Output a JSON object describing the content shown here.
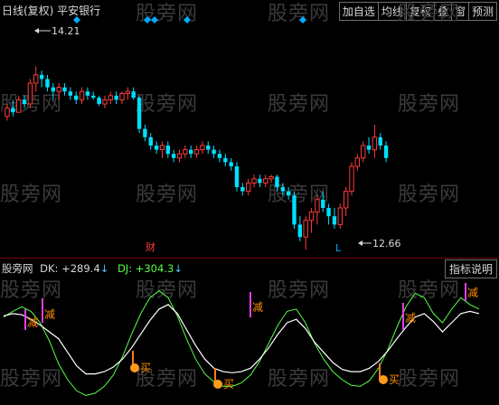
{
  "chart_title": "日线(复权) 平安银行",
  "toolbar": [
    "加自选",
    "均线",
    "复权",
    "叠",
    "窗",
    "预测"
  ],
  "watermark": "股旁网",
  "price": {
    "high_label": "14.21",
    "low_label": "12.66",
    "event_marker": "财",
    "low_marker": "L"
  },
  "indicator": {
    "name": "股旁网",
    "dk_label": "DK:",
    "dk_value": "+289.4",
    "dk_arrow": "↓",
    "dj_label": "DJ:",
    "dj_value": "+304.3",
    "dj_arrow": "↓",
    "help_button": "指标说明",
    "sell_label": "减",
    "buy_label": "买"
  },
  "colors": {
    "up": "#ff3b3b",
    "down": "#00e0ff",
    "dk_line": "#ffffff",
    "dj_line": "#55ff44",
    "sell_bar": "#e040e0",
    "buy_bar": "#ff7a1a",
    "diamond": "#00aaff"
  },
  "candles": [
    {
      "o": 2,
      "h": 5,
      "l": 1,
      "c": 4
    },
    {
      "o": 4,
      "h": 6,
      "l": 2,
      "c": 3
    },
    {
      "o": 3,
      "h": 7,
      "l": 3,
      "c": 6
    },
    {
      "o": 6,
      "h": 7,
      "l": 4,
      "c": 5
    },
    {
      "o": 5,
      "h": 11,
      "l": 4,
      "c": 10
    },
    {
      "o": 10,
      "h": 14,
      "l": 8,
      "c": 12
    },
    {
      "o": 12,
      "h": 13,
      "l": 9,
      "c": 11
    },
    {
      "o": 11,
      "h": 12,
      "l": 8,
      "c": 9
    },
    {
      "o": 9,
      "h": 10,
      "l": 6,
      "c": 8
    },
    {
      "o": 8,
      "h": 10,
      "l": 6,
      "c": 9
    },
    {
      "o": 9,
      "h": 10,
      "l": 7,
      "c": 8
    },
    {
      "o": 8,
      "h": 9,
      "l": 6,
      "c": 7
    },
    {
      "o": 7,
      "h": 8,
      "l": 5,
      "c": 6
    },
    {
      "o": 6,
      "h": 9,
      "l": 5,
      "c": 8
    },
    {
      "o": 8,
      "h": 9,
      "l": 6,
      "c": 7
    },
    {
      "o": 7,
      "h": 8,
      "l": 6,
      "c": 6.5
    },
    {
      "o": 6.5,
      "h": 7,
      "l": 4.5,
      "c": 5
    },
    {
      "o": 5,
      "h": 7,
      "l": 4,
      "c": 6
    },
    {
      "o": 6,
      "h": 8,
      "l": 5,
      "c": 7
    },
    {
      "o": 7,
      "h": 8,
      "l": 5,
      "c": 6
    },
    {
      "o": 6,
      "h": 8,
      "l": 5,
      "c": 7.5
    },
    {
      "o": 7.5,
      "h": 9,
      "l": 6,
      "c": 8
    },
    {
      "o": 8,
      "h": 9,
      "l": 6,
      "c": 6.5
    },
    {
      "o": 6.5,
      "h": 7,
      "l": -2,
      "c": -1
    },
    {
      "o": -1,
      "h": 0,
      "l": -4,
      "c": -3
    },
    {
      "o": -3,
      "h": -2,
      "l": -6,
      "c": -5
    },
    {
      "o": -5,
      "h": -4,
      "l": -7,
      "c": -6
    },
    {
      "o": -6,
      "h": -4,
      "l": -8,
      "c": -5
    },
    {
      "o": -5,
      "h": -4,
      "l": -8,
      "c": -7
    },
    {
      "o": -7,
      "h": -6,
      "l": -9,
      "c": -8
    },
    {
      "o": -8,
      "h": -6,
      "l": -9,
      "c": -7
    },
    {
      "o": -7,
      "h": -5,
      "l": -8,
      "c": -6
    },
    {
      "o": -6,
      "h": -5,
      "l": -8,
      "c": -7
    },
    {
      "o": -7,
      "h": -5,
      "l": -8,
      "c": -6
    },
    {
      "o": -6,
      "h": -4,
      "l": -7,
      "c": -5
    },
    {
      "o": -5,
      "h": -4,
      "l": -7,
      "c": -6
    },
    {
      "o": -6,
      "h": -5,
      "l": -8,
      "c": -7
    },
    {
      "o": -7,
      "h": -6,
      "l": -9,
      "c": -8
    },
    {
      "o": -8,
      "h": -7,
      "l": -10,
      "c": -9
    },
    {
      "o": -9,
      "h": -8,
      "l": -11,
      "c": -10
    },
    {
      "o": -10,
      "h": -9,
      "l": -16,
      "c": -15
    },
    {
      "o": -15,
      "h": -14,
      "l": -17,
      "c": -16
    },
    {
      "o": -16,
      "h": -13,
      "l": -17,
      "c": -14
    },
    {
      "o": -14,
      "h": -12,
      "l": -15,
      "c": -13
    },
    {
      "o": -13,
      "h": -12,
      "l": -15,
      "c": -14
    },
    {
      "o": -14,
      "h": -12,
      "l": -15,
      "c": -13
    },
    {
      "o": -13,
      "h": -12,
      "l": -14,
      "c": -12.5
    },
    {
      "o": -12.5,
      "h": -12,
      "l": -16,
      "c": -15
    },
    {
      "o": -15,
      "h": -14,
      "l": -17,
      "c": -16
    },
    {
      "o": -16,
      "h": -15,
      "l": -18,
      "c": -17
    },
    {
      "o": -17,
      "h": -16,
      "l": -25,
      "c": -24
    },
    {
      "o": -24,
      "h": -22,
      "l": -28,
      "c": -27
    },
    {
      "o": -27,
      "h": -22,
      "l": -30,
      "c": -23
    },
    {
      "o": -23,
      "h": -20,
      "l": -26,
      "c": -21
    },
    {
      "o": -21,
      "h": -17,
      "l": -24,
      "c": -18
    },
    {
      "o": -18,
      "h": -16,
      "l": -21,
      "c": -20
    },
    {
      "o": -20,
      "h": -19,
      "l": -24,
      "c": -22
    },
    {
      "o": -22,
      "h": -20,
      "l": -25,
      "c": -24
    },
    {
      "o": -24,
      "h": -19,
      "l": -25,
      "c": -20
    },
    {
      "o": -20,
      "h": -15,
      "l": -22,
      "c": -16
    },
    {
      "o": -16,
      "h": -9,
      "l": -17,
      "c": -10
    },
    {
      "o": -10,
      "h": -7,
      "l": -11,
      "c": -8
    },
    {
      "o": -8,
      "h": -4,
      "l": -9,
      "c": -5
    },
    {
      "o": -5,
      "h": -3,
      "l": -7,
      "c": -6
    },
    {
      "o": -6,
      "h": 0,
      "l": -8,
      "c": -3
    },
    {
      "o": -3,
      "h": -2,
      "l": -6,
      "c": -5
    },
    {
      "o": -5,
      "h": -4,
      "l": -9,
      "c": -8
    }
  ],
  "chart_data": {
    "type": "line",
    "series": [
      {
        "name": "DK",
        "values": [
          0.56,
          0.58,
          0.57,
          0.53,
          0.48,
          0.42,
          0.36,
          0.24,
          0.12,
          0.05,
          0.05,
          0.07,
          0.11,
          0.18,
          0.28,
          0.4,
          0.52,
          0.62,
          0.66,
          0.58,
          0.44,
          0.3,
          0.18,
          0.1,
          0.07,
          0.06,
          0.07,
          0.1,
          0.18,
          0.28,
          0.4,
          0.5,
          0.53,
          0.45,
          0.33,
          0.24,
          0.15,
          0.09,
          0.07,
          0.07,
          0.1,
          0.16,
          0.25,
          0.36,
          0.46,
          0.55,
          0.58,
          0.51,
          0.42,
          0.5,
          0.58,
          0.6,
          0.58
        ]
      },
      {
        "name": "DJ",
        "values": [
          0.55,
          0.6,
          0.64,
          0.6,
          0.5,
          0.34,
          0.14,
          0.0,
          -0.1,
          -0.14,
          -0.12,
          -0.06,
          0.04,
          0.2,
          0.4,
          0.58,
          0.72,
          0.78,
          0.72,
          0.56,
          0.36,
          0.18,
          0.05,
          -0.02,
          -0.06,
          -0.06,
          -0.03,
          0.04,
          0.16,
          0.32,
          0.48,
          0.6,
          0.62,
          0.5,
          0.32,
          0.18,
          0.07,
          0.0,
          -0.05,
          -0.06,
          -0.01,
          0.1,
          0.26,
          0.46,
          0.64,
          0.76,
          0.72,
          0.58,
          0.5,
          0.62,
          0.72,
          0.66,
          0.62
        ]
      }
    ]
  }
}
